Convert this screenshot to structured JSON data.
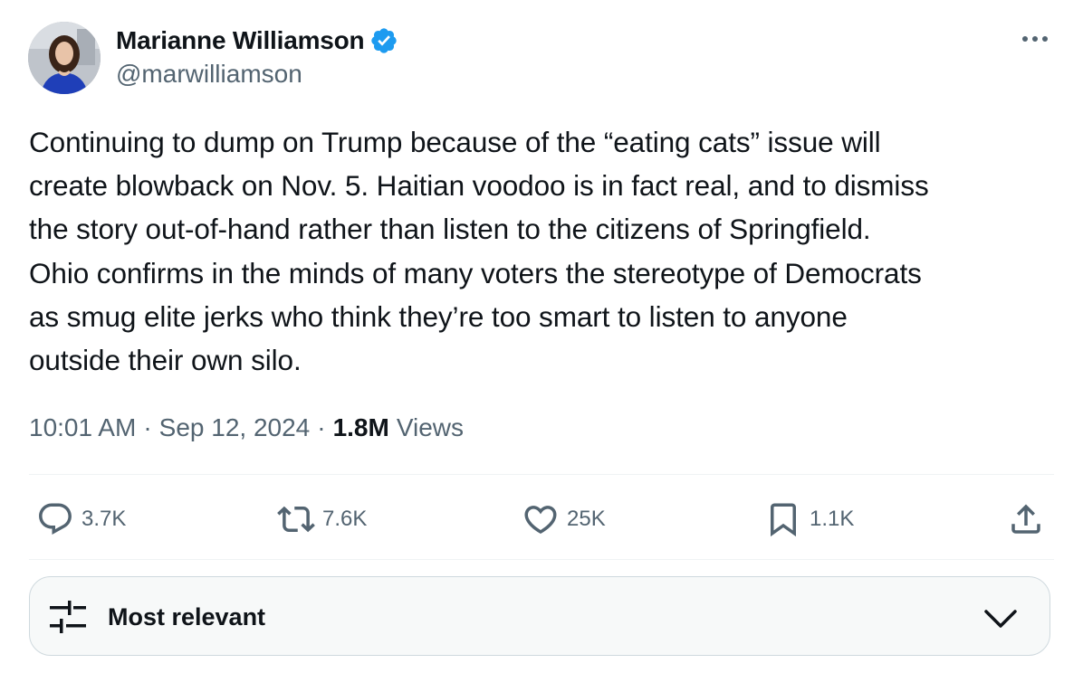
{
  "author": {
    "display_name": "Marianne Williamson",
    "handle": "@marwilliamson",
    "verified": true,
    "verified_color": "#1d9bf0"
  },
  "tweet": {
    "text": "Continuing to dump on Trump because of the “eating cats” issue will\ncreate blowback on Nov. 5. Haitian voodoo is in fact real, and to dismiss\nthe story out-of-hand rather than listen to the citizens of Springfield.\nOhio confirms in the minds of many voters the stereotype of Democrats\nas smug elite jerks who think they’re too smart to listen to anyone\noutside their own silo.",
    "time": "10:01 AM",
    "separator": "·",
    "date": "Sep 12, 2024",
    "views_count": "1.8M",
    "views_label": "Views"
  },
  "actions": {
    "replies": {
      "icon": "reply-icon",
      "count": "3.7K"
    },
    "reposts": {
      "icon": "repost-icon",
      "count": "7.6K"
    },
    "likes": {
      "icon": "heart-icon",
      "count": "25K"
    },
    "bookmarks": {
      "icon": "bookmark-icon",
      "count": "1.1K"
    },
    "share": {
      "icon": "share-icon"
    }
  },
  "sort": {
    "label": "Most relevant",
    "icon": "sort-sliders-icon"
  },
  "colors": {
    "text_primary": "#0f1419",
    "text_secondary": "#536471",
    "divider": "#eff3f4"
  }
}
